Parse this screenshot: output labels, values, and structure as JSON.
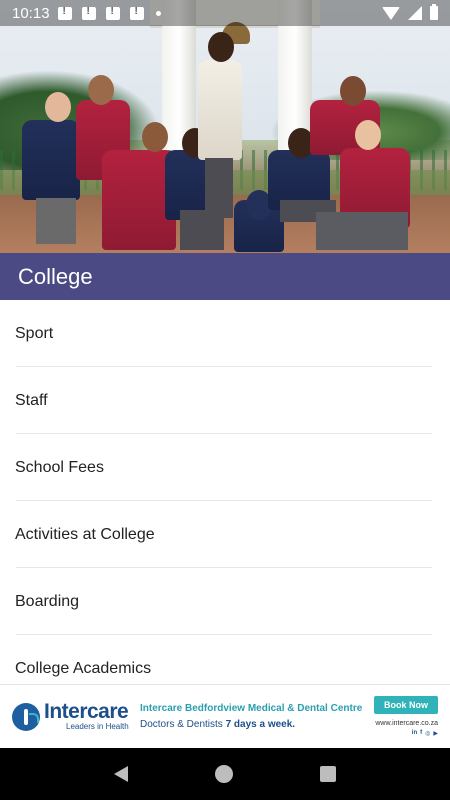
{
  "status_bar": {
    "time": "10:13",
    "notification_icons": [
      "alert-notification-icon",
      "alert-notification-icon",
      "alert-notification-icon",
      "alert-notification-icon"
    ],
    "right_icons": [
      "wifi-icon",
      "signal-icon",
      "battery-icon"
    ]
  },
  "header": {
    "title": "College",
    "background_color": "#4b4a85"
  },
  "menu": {
    "items": [
      {
        "label": "Sport"
      },
      {
        "label": "Staff"
      },
      {
        "label": "School Fees"
      },
      {
        "label": "Activities at College"
      },
      {
        "label": "Boarding"
      },
      {
        "label": "College Academics"
      }
    ]
  },
  "ad": {
    "brand": "Intercare",
    "tagline": "Leaders in Health",
    "headline": "Intercare Bedfordview Medical & Dental Centre",
    "sub_prefix": "Doctors & Dentists ",
    "sub_bold": "7 days a week.",
    "button_label": "Book Now",
    "url": "www.intercare.co.za",
    "socials": [
      "in",
      "f",
      "◎",
      "▶"
    ],
    "accent_color": "#2fb3b8",
    "brand_color": "#1d4f8a"
  },
  "nav_bar": {
    "buttons": [
      "back-icon",
      "home-icon",
      "recents-icon"
    ]
  }
}
